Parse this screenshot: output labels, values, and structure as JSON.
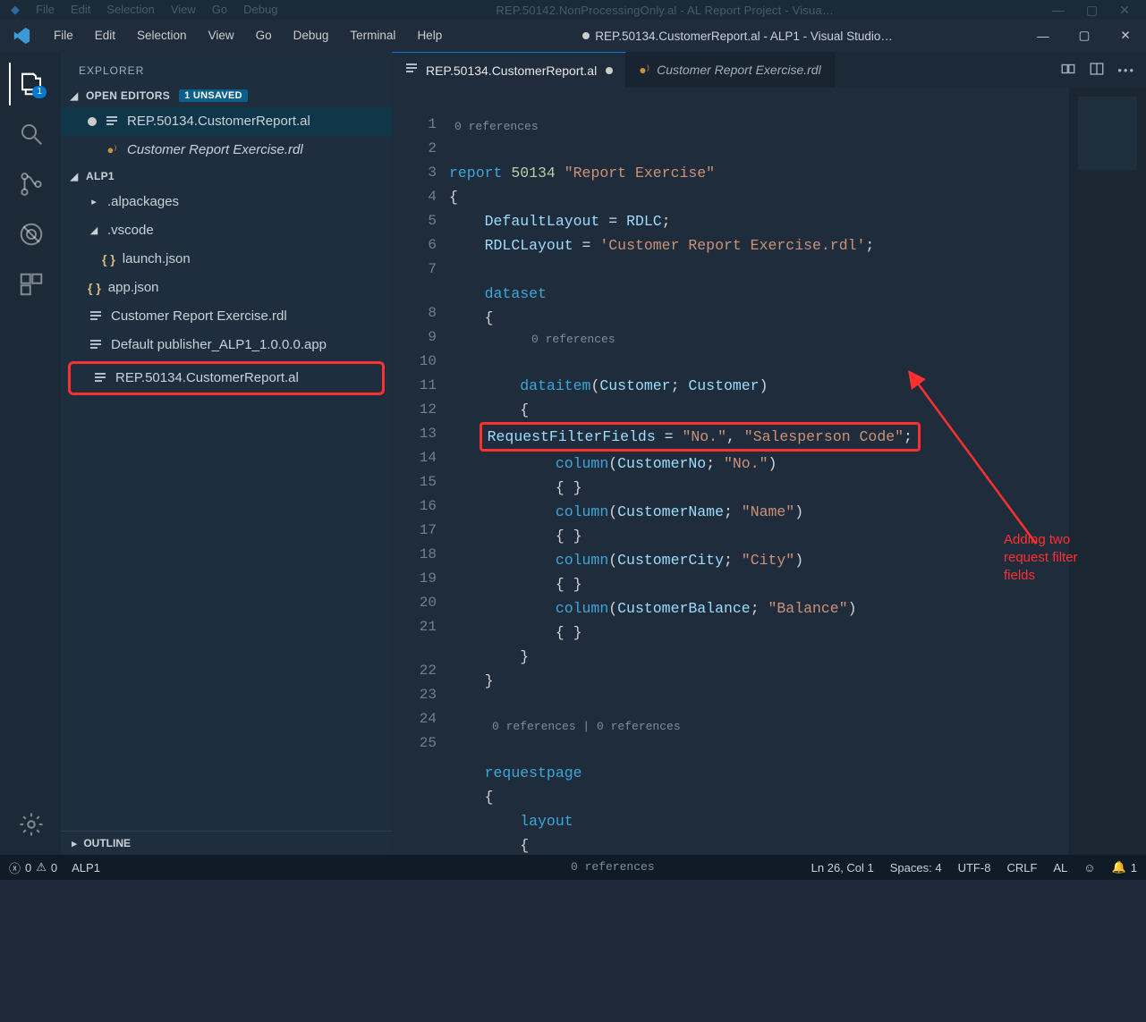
{
  "ghostWindow": {
    "menu": [
      "File",
      "Edit",
      "Selection",
      "View",
      "Go",
      "Debug"
    ],
    "title": "REP.50142.NonProcessingOnly.al - AL Report Project - Visua…"
  },
  "titlebar": {
    "menu": [
      "File",
      "Edit",
      "Selection",
      "View",
      "Go",
      "Debug",
      "Terminal",
      "Help"
    ],
    "title": "REP.50134.CustomerReport.al - ALP1 - Visual Studio…"
  },
  "activitybar": {
    "explorerBadge": "1"
  },
  "sidebar": {
    "header": "EXPLORER",
    "openEditors": {
      "label": "OPEN EDITORS",
      "unsavedBadge": "1 UNSAVED",
      "items": [
        {
          "name": "REP.50134.CustomerReport.al",
          "modified": true,
          "icon": "lines"
        },
        {
          "name": "Customer Report Exercise.rdl",
          "modified": false,
          "icon": "rss"
        }
      ]
    },
    "project": {
      "name": "ALP1",
      "items": [
        {
          "indent": 1,
          "chev": "▸",
          "name": ".alpackages",
          "icon": ""
        },
        {
          "indent": 1,
          "chev": "◢",
          "name": ".vscode",
          "icon": ""
        },
        {
          "indent": 2,
          "chev": "",
          "name": "launch.json",
          "icon": "braces"
        },
        {
          "indent": 1,
          "chev": "",
          "name": "app.json",
          "icon": "braces"
        },
        {
          "indent": 1,
          "chev": "",
          "name": "Customer Report Exercise.rdl",
          "icon": "lines"
        },
        {
          "indent": 1,
          "chev": "",
          "name": "Default publisher_ALP1_1.0.0.0.app",
          "icon": "lines"
        }
      ],
      "highlightedItem": {
        "name": "REP.50134.CustomerReport.al",
        "icon": "lines"
      }
    },
    "outline": "OUTLINE"
  },
  "tabs": [
    {
      "label": "REP.50134.CustomerReport.al",
      "active": true,
      "modified": true,
      "icon": "lines",
      "italic": false
    },
    {
      "label": "Customer Report Exercise.rdl",
      "active": false,
      "modified": false,
      "icon": "rss",
      "italic": true
    }
  ],
  "refStrings": {
    "r0": "0 references",
    "r00": "0 references | 0 references"
  },
  "code": {
    "l1a": "report",
    "l1b": "50134",
    "l1c": "\"Report Exercise\"",
    "l2": "{",
    "l3a": "DefaultLayout",
    "l3b": " = ",
    "l3c": "RDLC",
    "l3d": ";",
    "l4a": "RDLCLayout",
    "l4b": " = ",
    "l4c": "'Customer Report Exercise.rdl'",
    "l4d": ";",
    "l6a": "dataset",
    "l7": "{",
    "l8a": "dataitem",
    "l8b": "(",
    "l8c": "Customer",
    "l8d": "; ",
    "l8e": "Customer",
    "l8f": ")",
    "l9": "{",
    "l10a": "RequestFilterFields",
    "l10b": " = ",
    "l10c": "\"No.\"",
    "l10d": ", ",
    "l10e": "\"Salesperson Code\"",
    "l10f": ";",
    "l11a": "column",
    "l11b": "(",
    "l11c": "CustomerNo",
    "l11d": "; ",
    "l11e": "\"No.\"",
    "l11f": ")",
    "l12": "{ }",
    "l13a": "column",
    "l13b": "(",
    "l13c": "CustomerName",
    "l13d": "; ",
    "l13e": "\"Name\"",
    "l13f": ")",
    "l14": "{ }",
    "l15a": "column",
    "l15b": "(",
    "l15c": "CustomerCity",
    "l15d": "; ",
    "l15e": "\"City\"",
    "l15f": ")",
    "l16": "{ }",
    "l17a": "column",
    "l17b": "(",
    "l17c": "CustomerBalance",
    "l17d": "; ",
    "l17e": "\"Balance\"",
    "l17f": ")",
    "l18": "{ }",
    "l19": "}",
    "l20": "}",
    "l22a": "requestpage",
    "l23": "{",
    "l24a": "layout",
    "l25": "{"
  },
  "annotation": "Adding two\nrequest filter\nfields",
  "status": {
    "errors": "0",
    "warnings": "0",
    "project": "ALP1",
    "lncol": "Ln 26, Col 1",
    "spaces": "Spaces: 4",
    "encoding": "UTF-8",
    "eol": "CRLF",
    "lang": "AL",
    "bell": "1"
  }
}
